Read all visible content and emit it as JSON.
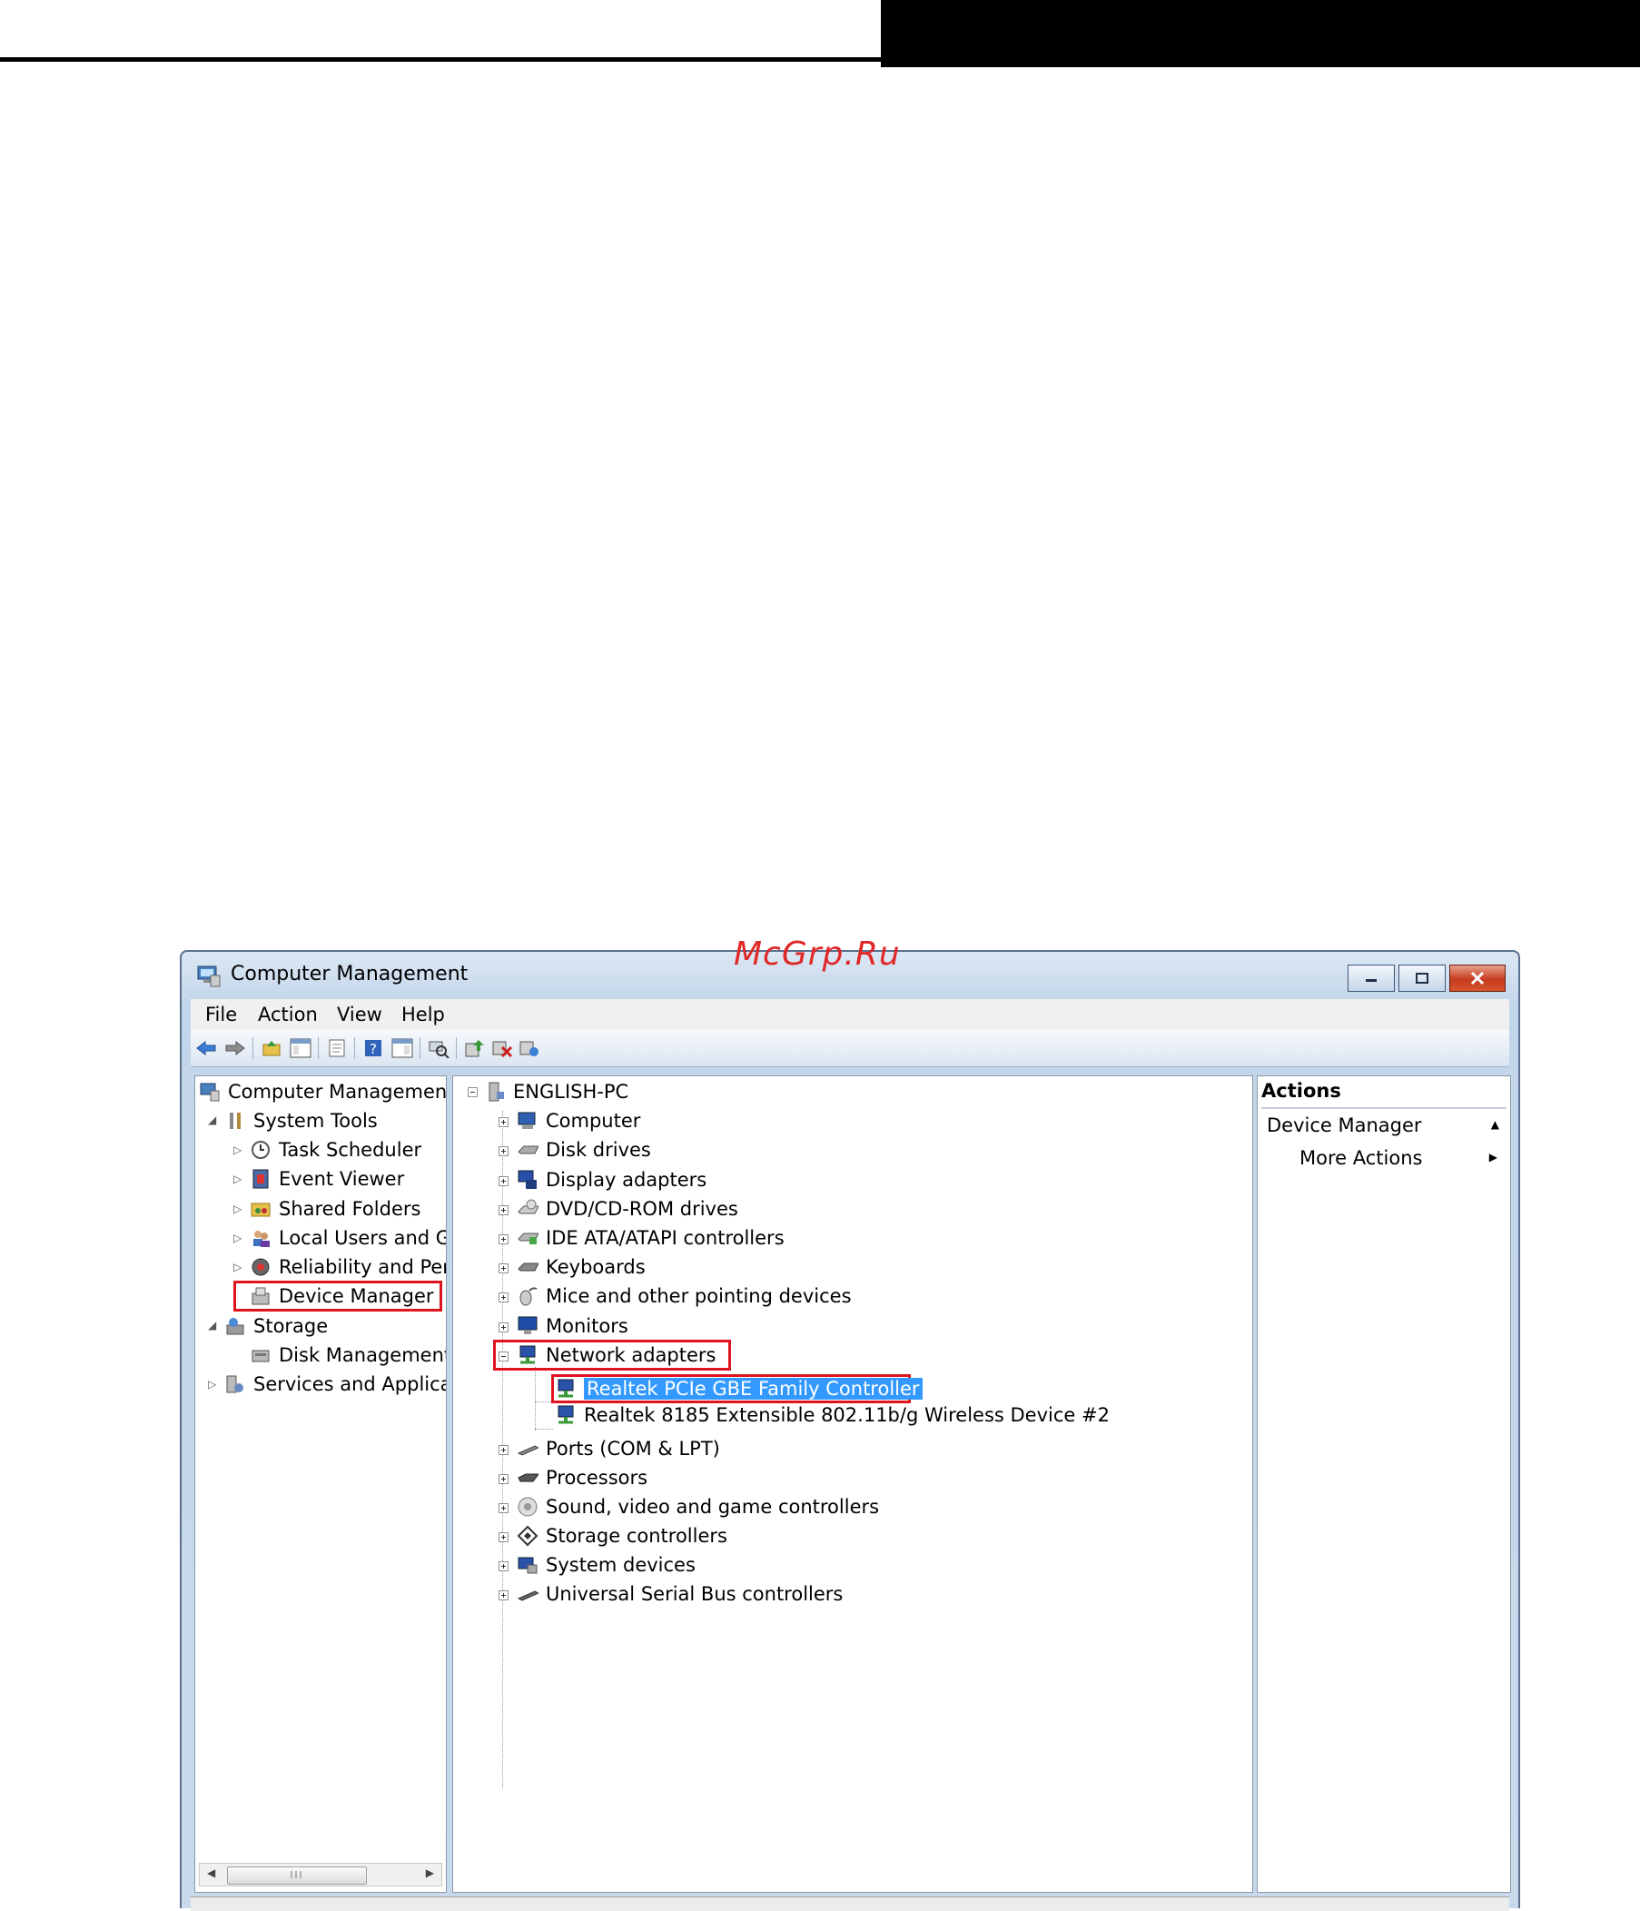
{
  "window": {
    "title": "Computer Management",
    "watermark": "McGrp.Ru"
  },
  "menu": [
    "File",
    "Action",
    "View",
    "Help"
  ],
  "left_tree": {
    "root": "Computer Management",
    "system_tools": "System Tools",
    "task_scheduler": "Task Scheduler",
    "event_viewer": "Event Viewer",
    "shared_folders": "Shared Folders",
    "local_users": "Local Users and Gr",
    "reliability": "Reliability and Perf",
    "device_manager": "Device Manager",
    "storage": "Storage",
    "disk_management": "Disk Management",
    "services": "Services and Applicat"
  },
  "device_tree": {
    "root": "ENGLISH-PC",
    "categories": [
      "Computer",
      "Disk drives",
      "Display adapters",
      "DVD/CD-ROM drives",
      "IDE ATA/ATAPI controllers",
      "Keyboards",
      "Mice and other pointing devices",
      "Monitors",
      "Network adapters"
    ],
    "network_children": [
      "Realtek PCIe GBE Family Controller",
      "Realtek 8185 Extensible 802.11b/g Wireless Device #2"
    ],
    "more_categories": [
      "Ports (COM & LPT)",
      "Processors",
      "Sound, video and game controllers",
      "Storage controllers",
      "System devices",
      "Universal Serial Bus controllers"
    ]
  },
  "actions": {
    "header": "Actions",
    "section": "Device Manager",
    "more": "More Actions"
  },
  "colors": {
    "highlight_box": "#e0141e",
    "selection": "#3399ff"
  }
}
